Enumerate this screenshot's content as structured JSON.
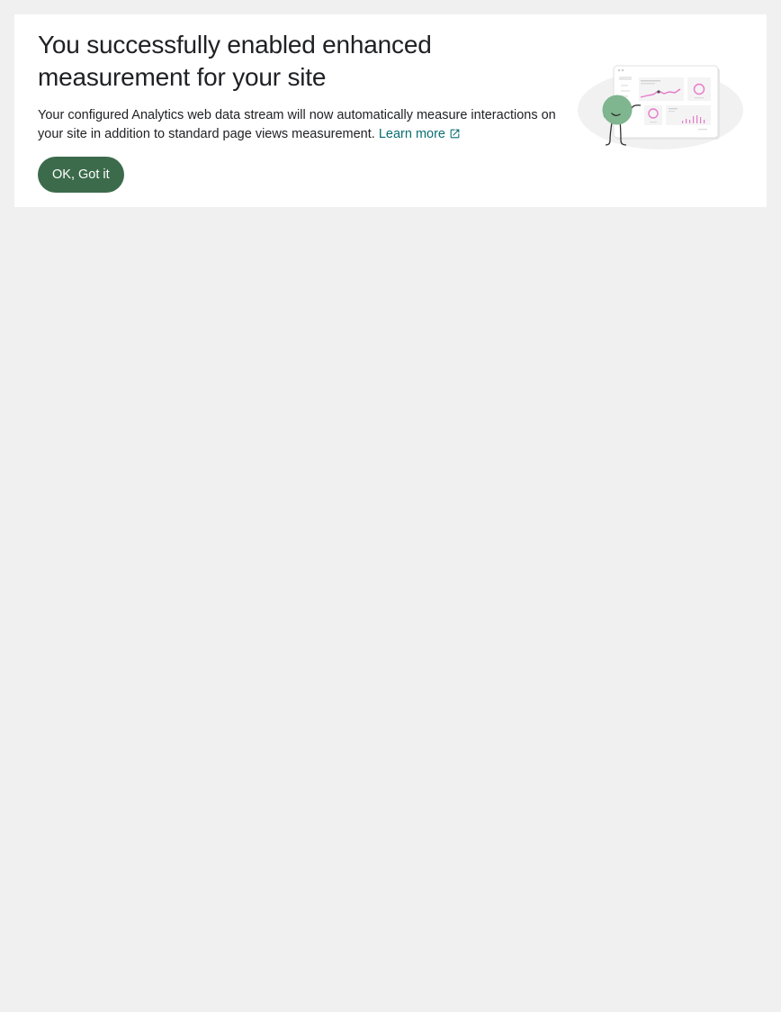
{
  "notice": {
    "title": "You successfully enabled enhanced measurement for your site",
    "description": "Your configured Analytics web data stream will now automatically measure interactions on your site in addition to standard page views measurement.",
    "learn_more_label": "Learn more",
    "learn_more_icon": "external-link-icon",
    "ok_button_label": "OK, Got it",
    "illustration": "analytics-dashboard-illustration"
  },
  "colors": {
    "page_background": "#f0f0f0",
    "card_background": "#ffffff",
    "button_background": "#3c6b4c",
    "link": "#0b6e74",
    "chart_accent": "#e779c9",
    "character_green": "#7fb58f"
  }
}
